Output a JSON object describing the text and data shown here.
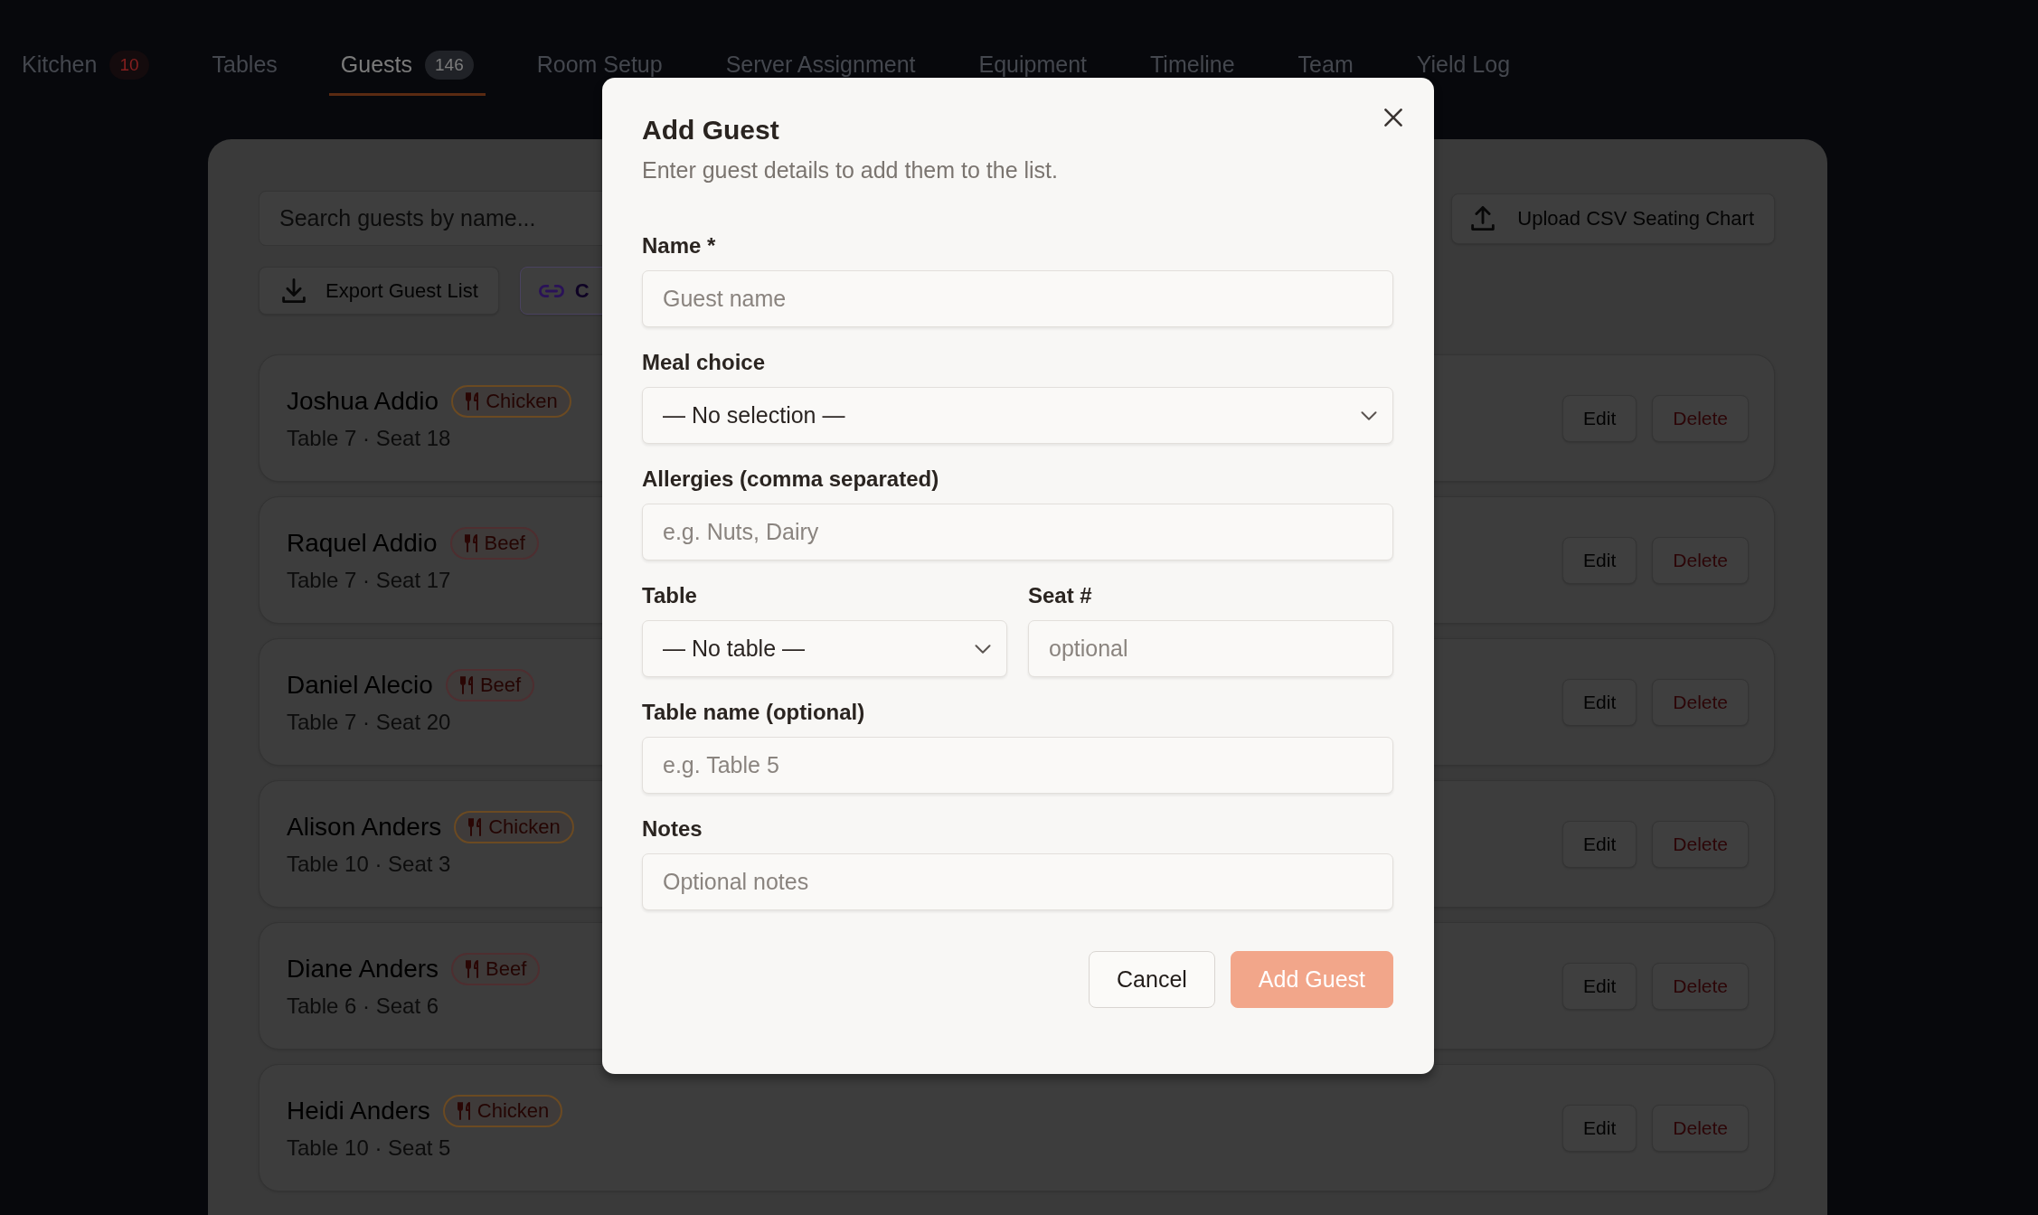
{
  "tabs": [
    {
      "label": "Kitchen",
      "selected": false,
      "badge": {
        "text": "10",
        "kind": "alert"
      }
    },
    {
      "label": "Tables",
      "selected": false
    },
    {
      "label": "Guests",
      "selected": true,
      "badge": {
        "text": "146",
        "kind": "count"
      }
    },
    {
      "label": "Room Setup",
      "selected": false
    },
    {
      "label": "Server Assignment",
      "selected": false
    },
    {
      "label": "Equipment",
      "selected": false
    },
    {
      "label": "Timeline",
      "selected": false
    },
    {
      "label": "Team",
      "selected": false
    },
    {
      "label": "Yield Log",
      "selected": false
    }
  ],
  "guest_panel": {
    "search": {
      "placeholder": "Search guests by name..."
    },
    "upload_button": {
      "label": "Upload CSV Seating Chart"
    },
    "actions": [
      {
        "label": "Export Guest List",
        "kind": "export"
      },
      {
        "label": "C",
        "kind": "link"
      }
    ],
    "guests": [
      {
        "name": "Joshua Addio",
        "meal": {
          "label": "Chicken",
          "color": "#6b4a22"
        },
        "seat_info": "Table 7 · Seat 18",
        "actions": [
          {
            "label": "Edit",
            "kind": "edit"
          },
          {
            "label": "Delete",
            "kind": "delete"
          }
        ]
      },
      {
        "name": "Raquel Addio",
        "meal": {
          "label": "Beef",
          "color": "#4e2e30"
        },
        "seat_info": "Table 7 · Seat 17",
        "actions": [
          {
            "label": "Edit",
            "kind": "edit"
          },
          {
            "label": "Delete",
            "kind": "delete"
          }
        ]
      },
      {
        "name": "Daniel Alecio",
        "meal": {
          "label": "Beef",
          "color": "#4e2e30"
        },
        "seat_info": "Table 7 · Seat 20",
        "actions": [
          {
            "label": "Edit",
            "kind": "edit"
          },
          {
            "label": "Delete",
            "kind": "delete"
          }
        ]
      },
      {
        "name": "Alison Anders",
        "meal": {
          "label": "Chicken",
          "color": "#6b4a22"
        },
        "seat_info": "Table 10 · Seat 3",
        "actions": [
          {
            "label": "Edit",
            "kind": "edit"
          },
          {
            "label": "Delete",
            "kind": "delete"
          }
        ]
      },
      {
        "name": "Diane Anders",
        "meal": {
          "label": "Beef",
          "color": "#4e2e30"
        },
        "seat_info": "Table 6 · Seat 6",
        "actions": [
          {
            "label": "Edit",
            "kind": "edit"
          },
          {
            "label": "Delete",
            "kind": "delete"
          }
        ]
      },
      {
        "name": "Heidi Anders",
        "meal": {
          "label": "Chicken",
          "color": "#6b4a22"
        },
        "seat_info": "Table 10 · Seat 5",
        "actions": [
          {
            "label": "Edit",
            "kind": "edit"
          },
          {
            "label": "Delete",
            "kind": "delete"
          }
        ]
      }
    ]
  },
  "dialog": {
    "title": "Add Guest",
    "subtitle": "Enter guest details to add them to the list.",
    "rows": [
      {
        "fields": [
          {
            "label": "Name *",
            "kind": "text",
            "placeholder": "Guest name"
          }
        ]
      },
      {
        "fields": [
          {
            "label": "Meal choice",
            "kind": "select",
            "value": "— No selection —"
          }
        ]
      },
      {
        "fields": [
          {
            "label": "Allergies (comma separated)",
            "kind": "text",
            "placeholder": "e.g. Nuts, Dairy"
          }
        ]
      },
      {
        "fields": [
          {
            "label": "Table",
            "kind": "select",
            "value": "— No table —"
          },
          {
            "label": "Seat #",
            "kind": "text",
            "placeholder": "optional"
          }
        ]
      },
      {
        "fields": [
          {
            "label": "Table name (optional)",
            "kind": "text",
            "placeholder": "e.g. Table 5"
          }
        ]
      },
      {
        "fields": [
          {
            "label": "Notes",
            "kind": "text",
            "placeholder": "Optional notes"
          }
        ]
      }
    ],
    "buttons": [
      {
        "label": "Cancel",
        "kind": "secondary",
        "disabled": false
      },
      {
        "label": "Add Guest",
        "kind": "primary",
        "disabled": true
      }
    ]
  }
}
